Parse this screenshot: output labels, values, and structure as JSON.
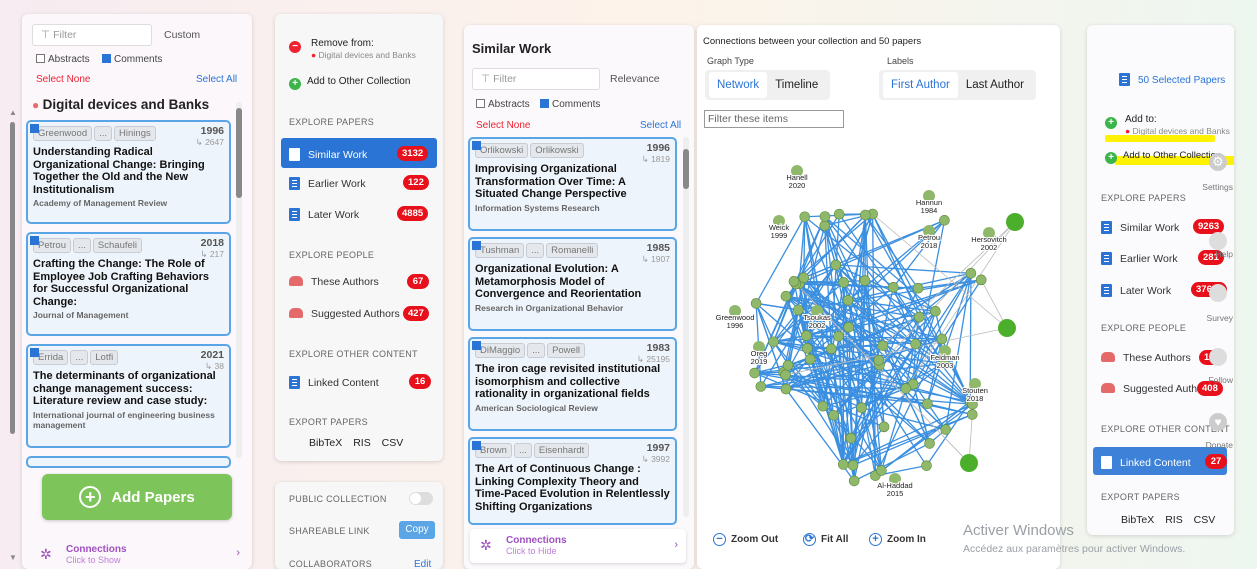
{
  "left": {
    "filter_placeholder": "Filter",
    "sort_label": "Custom",
    "abstracts_label": "Abstracts",
    "comments_label": "Comments",
    "select_none": "Select None",
    "select_all": "Select All",
    "collection_title": "Digital devices and Banks",
    "papers": [
      {
        "authors": [
          "Greenwood",
          "...",
          "Hinings"
        ],
        "year": "1996",
        "citations": "2647",
        "title": "Understanding Radical Organizational Change: Bringing Together the Old and the New Institutionalism",
        "journal": "Academy of Management Review"
      },
      {
        "authors": [
          "Petrou",
          "...",
          "Schaufeli"
        ],
        "year": "2018",
        "citations": "217",
        "title": "Crafting the Change: The Role of Employee Job Crafting Behaviors for Successful Organizational Change:",
        "journal": "Journal of Management"
      },
      {
        "authors": [
          "Errida",
          "...",
          "Lotfi"
        ],
        "year": "2021",
        "citations": "38",
        "title": "The determinants of organizational change management success: Literature review and case study:",
        "journal": "International journal of engineering business management"
      }
    ],
    "add_papers": "Add Papers",
    "connections_title": "Connections",
    "connections_sub": "Click to Show"
  },
  "middle": {
    "remove_from": "Remove from:",
    "remove_target": "Digital devices and Banks",
    "add_other": "Add to Other Collection",
    "explore_papers": "EXPLORE PAPERS",
    "similar_work": "Similar Work",
    "similar_count": "3132",
    "earlier_work": "Earlier Work",
    "earlier_count": "122",
    "later_work": "Later Work",
    "later_count": "4885",
    "explore_people": "EXPLORE PEOPLE",
    "these_authors": "These Authors",
    "these_count": "67",
    "suggested_authors": "Suggested Authors",
    "suggested_count": "427",
    "explore_other": "EXPLORE OTHER CONTENT",
    "linked_content": "Linked Content",
    "linked_count": "16",
    "export_papers": "EXPORT PAPERS",
    "export": [
      "BibTeX",
      "RIS",
      "CSV"
    ],
    "public_collection": "PUBLIC COLLECTION",
    "shareable_link": "SHAREABLE LINK",
    "copy": "Copy",
    "collaborators": "COLLABORATORS",
    "edit": "Edit"
  },
  "similar": {
    "title": "Similar Work",
    "filter_placeholder": "Filter",
    "sort_label": "Relevance",
    "abstracts_label": "Abstracts",
    "comments_label": "Comments",
    "select_none": "Select None",
    "select_all": "Select All",
    "papers": [
      {
        "authors": [
          "Orlikowski",
          "Orlikowski"
        ],
        "year": "1996",
        "citations": "1819",
        "title": "Improvising Organizational Transformation Over Time: A Situated Change Perspective",
        "journal": "Information Systems Research"
      },
      {
        "authors": [
          "Tushman",
          "...",
          "Romanelli"
        ],
        "year": "1985",
        "citations": "1907",
        "title": "Organizational Evolution: A Metamorphosis Model of Convergence and Reorientation",
        "journal": "Research in Organizational Behavior"
      },
      {
        "authors": [
          "DiMaggio",
          "...",
          "Powell"
        ],
        "year": "1983",
        "citations": "25195",
        "title": "The iron cage revisited institutional isomorphism and collective rationality in organizational fields",
        "journal": "American Sociological Review"
      },
      {
        "authors": [
          "Brown",
          "...",
          "Eisenhardt"
        ],
        "year": "1997",
        "citations": "3992",
        "title": "The Art of Continuous Change : Linking Complexity Theory and Time-Paced Evolution in Relentlessly Shifting Organizations",
        "journal": ""
      }
    ],
    "connections_title": "Connections",
    "connections_sub": "Click to Hide"
  },
  "graph": {
    "header": "Connections between your collection and 50 papers",
    "graph_type_label": "Graph Type",
    "network": "Network",
    "timeline": "Timeline",
    "labels_label": "Labels",
    "first_author": "First Author",
    "last_author": "Last Author",
    "filter_placeholder": "Filter these items",
    "nodes": [
      "Hanell 2020",
      "Hannun 1984",
      "Weick 1999",
      "Petrou 2018",
      "Hersovitch 2002",
      "Greenwood 1996",
      "Tsoukas 2002",
      "Oreg 2019",
      "Feldman 2003",
      "Stouten 2018",
      "Al-Haddad 2015"
    ],
    "zoom_out": "Zoom Out",
    "fit_all": "Fit All",
    "zoom_in": "Zoom In"
  },
  "right": {
    "selected": "50 Selected Papers",
    "add_to": "Add to:",
    "add_target": "Digital devices and Banks",
    "add_other": "Add to Other Collection",
    "explore_papers": "EXPLORE PAPERS",
    "similar_work": "Similar Work",
    "similar_count": "9263",
    "earlier_work": "Earlier Work",
    "earlier_count": "281",
    "later_work": "Later Work",
    "later_count": "37684",
    "explore_people": "EXPLORE PEOPLE",
    "these_authors": "These Authors",
    "these_count": "153",
    "suggested_authors": "Suggested Authors",
    "suggested_count": "408",
    "explore_other": "EXPLORE OTHER CONTENT",
    "linked_content": "Linked Content",
    "linked_count": "27",
    "export_papers": "EXPORT PAPERS",
    "export": [
      "BibTeX",
      "RIS",
      "CSV"
    ],
    "side_labels": [
      "Settings",
      "Help",
      "Survey",
      "Follow",
      "Donate"
    ]
  },
  "watermark": {
    "title": "Activer Windows",
    "sub": "Accédez aux paramètres pour activer Windows."
  },
  "colors": {
    "accent": "#2a74d6",
    "badge": "#e8101a",
    "add_papers": "#7dc55a",
    "highlight": "#fff200"
  }
}
